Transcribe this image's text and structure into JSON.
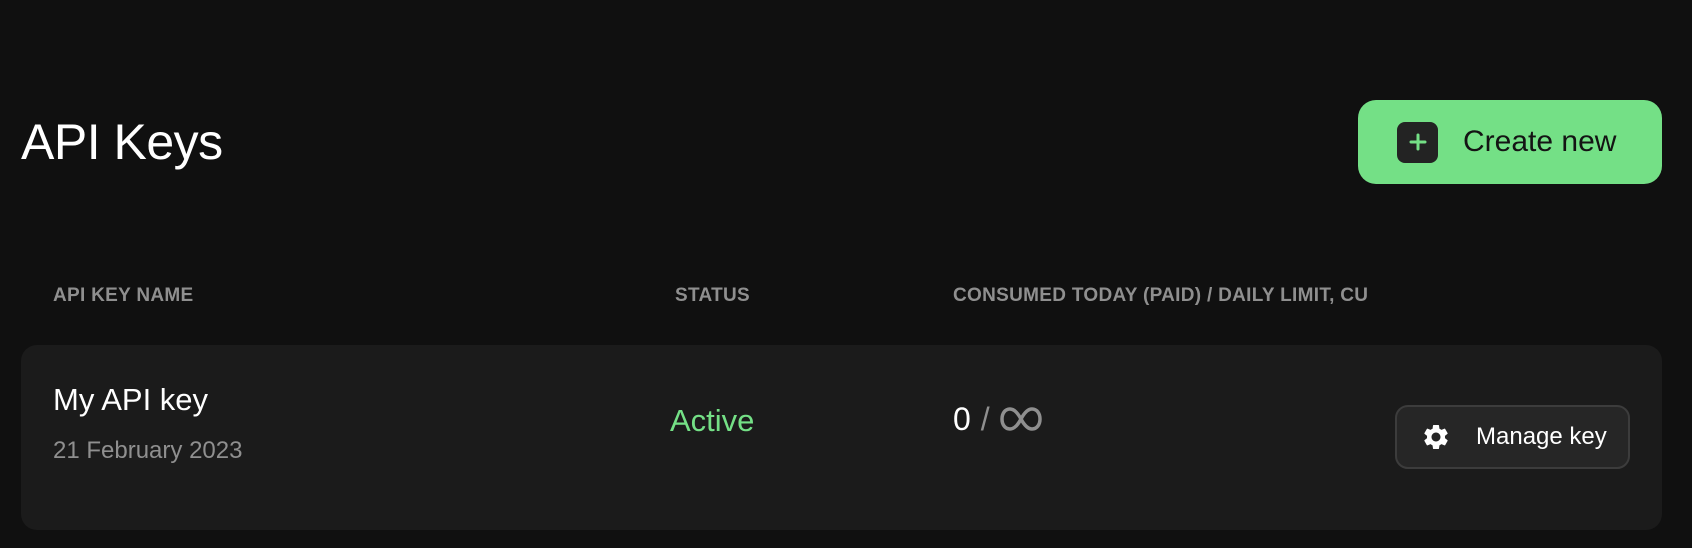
{
  "header": {
    "title": "API Keys",
    "create_button_label": "Create new",
    "create_icon": "plus-icon"
  },
  "table": {
    "columns": [
      "API KEY NAME",
      "STATUS",
      "CONSUMED TODAY (PAID) / DAILY LIMIT, CU"
    ],
    "rows": [
      {
        "name": "My API key",
        "date": "21 February 2023",
        "status": "Active",
        "consumed": "0",
        "separator": "/",
        "limit_icon": "infinity-icon",
        "manage_label": "Manage key",
        "manage_icon": "gear-icon"
      }
    ]
  },
  "colors": {
    "background": "#101010",
    "accent": "#74e086",
    "card": "#1b1b1b",
    "muted_text": "#8f8f8f"
  }
}
